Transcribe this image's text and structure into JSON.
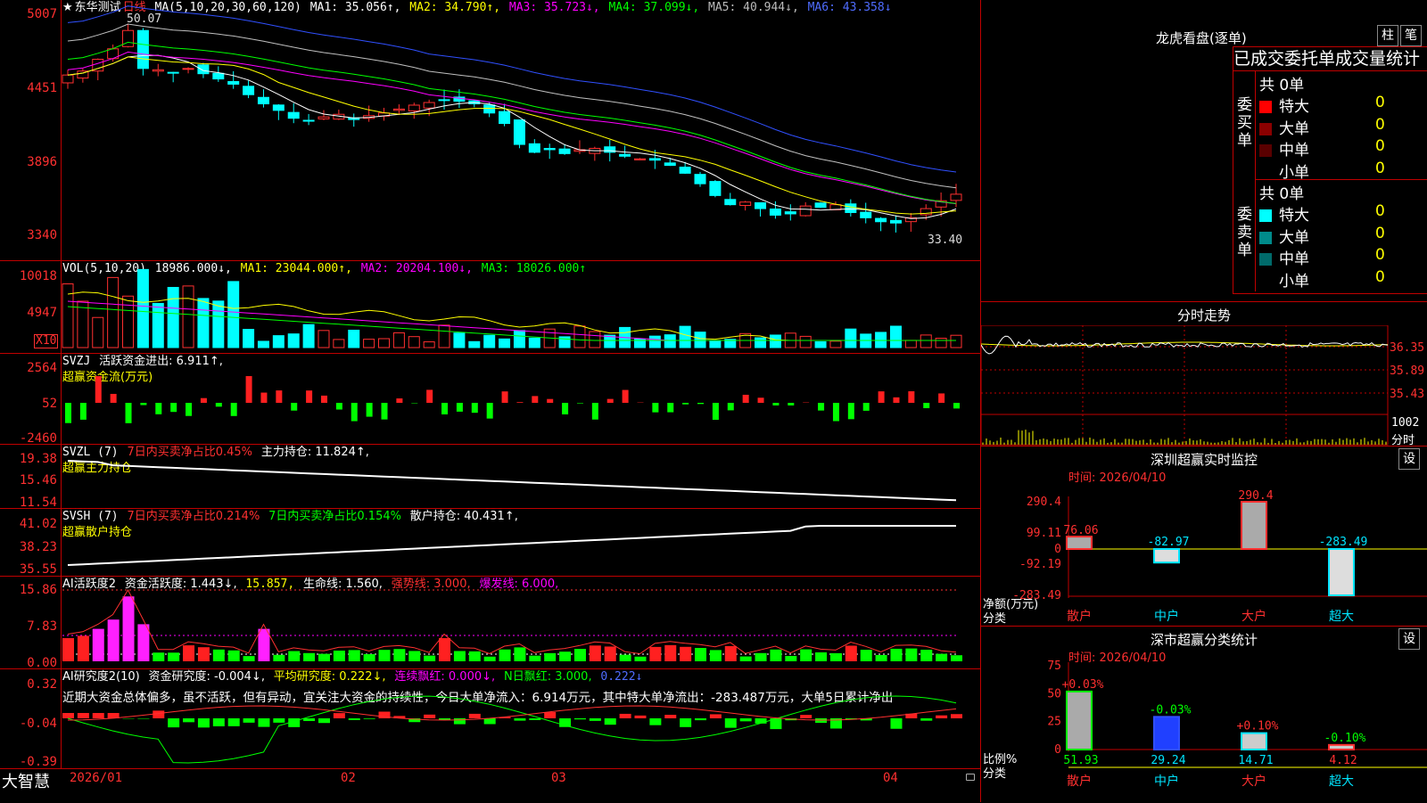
{
  "header": {
    "star": "★",
    "stock_name": "东华测试",
    "period": "日线",
    "ma_label": "MA(5,10,20,30,60,120)",
    "ma1": "MA1: 35.056↑,",
    "ma2": "MA2: 34.790↑,",
    "ma3": "MA3: 35.723↓,",
    "ma4": "MA4: 37.099↓,",
    "ma5": "MA5: 40.944↓,",
    "ma6": "MA6: 43.358↓"
  },
  "main_axis": [
    "5007",
    "4451",
    "3896",
    "3340"
  ],
  "main_annotations": {
    "high": "50.07",
    "low": "33.40"
  },
  "vol": {
    "label": "VOL(5,10,20)",
    "value": "18986.000↓,",
    "ma1": "MA1: 23044.000↑,",
    "ma2": "MA2: 20204.100↓,",
    "ma3": "MA3: 18026.000↑",
    "axis": [
      "10018",
      "4947"
    ],
    "unit": "X10"
  },
  "svzj": {
    "label": "SVZJ",
    "text": "活跃资金进出: 6.911↑,",
    "sub": "超赢资金流(万元)",
    "axis": [
      "2564",
      "52",
      "-2460"
    ]
  },
  "svzl": {
    "label": "SVZL (7)",
    "t1": "7日内买卖净占比0.45%",
    "t2": "主力持仓: 11.824↑,",
    "sub": "超赢主力持仓",
    "axis": [
      "19.38",
      "15.46",
      "11.54"
    ]
  },
  "svsh": {
    "label": "SVSH (7)",
    "t1": "7日内买卖净占比0.214%",
    "t2": "7日内买卖净占比0.154%",
    "t3": "散户持仓: 40.431↑,",
    "sub": "超赢散户持仓",
    "axis": [
      "41.02",
      "38.23",
      "35.55"
    ]
  },
  "ai": {
    "label": "AI活跃度2",
    "t1": "资金活跃度: 1.443↓,",
    "t2": "15.857,",
    "t3": "生命线: 1.560,",
    "t4": "强势线: 3.000,",
    "t5": "爆发线: 6.000,",
    "axis": [
      "15.86",
      "7.83",
      "0.00"
    ]
  },
  "research": {
    "label": "AI研究度2(10)",
    "t1": "资金研究度: -0.004↓,",
    "t2": "平均研究度: 0.222↓,",
    "t3": "连续飘红: 0.000↓,",
    "t4": "N日飘红: 3.000,",
    "t5": "0.222↓",
    "comment": "近期大资金总体偏多，虽不活跃，但有异动，宜关注大资金的持续性，今日大单净流入：6.914万元，其中特大单净流出：-283.487万元，大单5日累计净出",
    "axis": [
      "0.32",
      "-0.04",
      "-0.39"
    ]
  },
  "bottom": {
    "logo": "大智慧",
    "dates": [
      "2026/01",
      "02",
      "03",
      "04"
    ]
  },
  "dragon": {
    "title": "龙虎看盘(逐单)",
    "btn1": "柱",
    "btn2": "笔",
    "subtitle": "已成交委托单成交量统计",
    "buy_label": "委买单",
    "sell_label": "委卖单",
    "buy_total": "共 0单",
    "sell_total": "共 0单",
    "buy_rows": [
      {
        "name": "特大",
        "count": "0",
        "pct": "0%",
        "color": "#ff0000"
      },
      {
        "name": "大单",
        "count": "0",
        "pct": "0%",
        "color": "#8b0000"
      },
      {
        "name": "中单",
        "count": "0",
        "pct": "0%",
        "color": "#5a0000"
      },
      {
        "name": "小单",
        "count": "0",
        "pct": "0%",
        "color": "#000000"
      }
    ],
    "sell_rows": [
      {
        "name": "特大",
        "count": "0",
        "pct": "0%",
        "color": "#00ffff"
      },
      {
        "name": "大单",
        "count": "0",
        "pct": "0%",
        "color": "#008b8b"
      },
      {
        "name": "中单",
        "count": "0",
        "pct": "0%",
        "color": "#006a6a"
      },
      {
        "name": "小单",
        "count": "0",
        "pct": "0%",
        "color": "#000000"
      }
    ]
  },
  "intraday": {
    "title": "分时走势",
    "axis": [
      "36.35",
      "35.89",
      "35.43",
      "1002",
      "分时"
    ]
  },
  "sz_monitor": {
    "title": "深圳超赢实时监控",
    "btn": "设",
    "time": "时间: 2026/04/10",
    "axis": [
      "290.4",
      "99.11",
      "0",
      "-92.19",
      "-283.49"
    ],
    "ylabel": "净额(万元)",
    "xlabel": "分类",
    "categories": [
      "散户",
      "中户",
      "大户",
      "超大"
    ],
    "values": [
      76.06,
      -82.97,
      290.4,
      -283.49
    ],
    "labels": [
      "76.06",
      "-82.97",
      "290.4",
      "-283.49"
    ]
  },
  "sz_class": {
    "title": "深市超赢分类统计",
    "btn": "设",
    "time": "时间: 2026/04/10",
    "axis": [
      "75",
      "50",
      "25",
      "0"
    ],
    "ylabel": "比例%",
    "xlabel": "分类",
    "categories": [
      "散户",
      "中户",
      "大户",
      "超大"
    ],
    "values": [
      51.93,
      29.24,
      14.71,
      4.12
    ],
    "labels": [
      "51.93",
      "29.24",
      "14.71",
      "4.12"
    ],
    "changes": [
      "+0.03%",
      "-0.03%",
      "+0.10%",
      "-0.10%"
    ]
  },
  "colors": {
    "up": "#ff3030",
    "down": "#00ffff",
    "frame": "#c00000",
    "ma1": "#ffffff",
    "ma2": "#ffff00",
    "ma3": "#ff00ff",
    "ma4": "#00ff00",
    "ma5": "#c0c0c0",
    "ma6": "#3050ff"
  }
}
